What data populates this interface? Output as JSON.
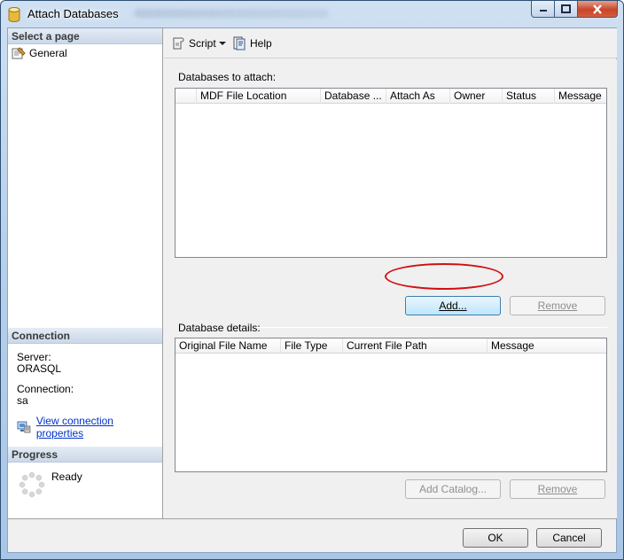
{
  "window": {
    "title": "Attach Databases"
  },
  "left": {
    "select_page_header": "Select a page",
    "pages": [
      {
        "label": "General"
      }
    ],
    "connection_header": "Connection",
    "server_label": "Server:",
    "server_value": "ORASQL",
    "connection_label": "Connection:",
    "connection_value": "sa",
    "view_props_link": "View connection properties",
    "progress_header": "Progress",
    "progress_status": "Ready"
  },
  "toolbar": {
    "script_label": "Script",
    "help_label": "Help"
  },
  "attach": {
    "label": "Databases to attach:",
    "columns": [
      "MDF File Location",
      "Database ...",
      "Attach As",
      "Owner",
      "Status",
      "Message"
    ],
    "add_button": "Add...",
    "remove_button": "Remove"
  },
  "details": {
    "label": "Database details:",
    "columns": [
      "Original File Name",
      "File Type",
      "Current File Path",
      "Message"
    ],
    "add_catalog_button": "Add Catalog...",
    "remove_button": "Remove"
  },
  "footer": {
    "ok_button": "OK",
    "cancel_button": "Cancel"
  },
  "colors": {
    "highlight_ring": "#d01010",
    "link": "#0033cc"
  }
}
